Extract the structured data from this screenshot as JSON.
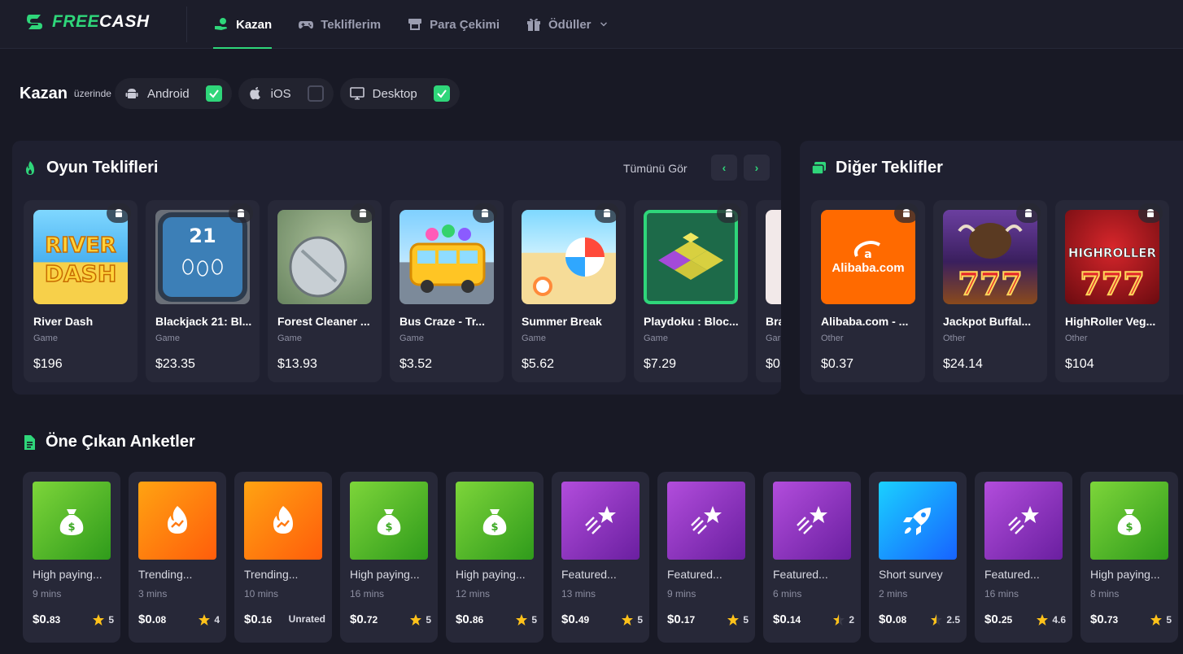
{
  "brand": {
    "free": "FREE",
    "cash": "CASH",
    "accent": "#2fd67a"
  },
  "nav": [
    {
      "label": "Kazan",
      "icon": "hand-coin-icon",
      "active": true
    },
    {
      "label": "Tekliflerim",
      "icon": "gamepad-icon",
      "active": false
    },
    {
      "label": "Para Çekimi",
      "icon": "atm-icon",
      "active": false
    },
    {
      "label": "Ödüller",
      "icon": "gift-icon",
      "active": false
    }
  ],
  "filter": {
    "title": "Kazan",
    "sub": "üzerinde",
    "platforms": [
      {
        "label": "Android",
        "icon": "android-icon",
        "checked": true
      },
      {
        "label": "iOS",
        "icon": "apple-icon",
        "checked": false
      },
      {
        "label": "Desktop",
        "icon": "monitor-icon",
        "checked": true
      }
    ]
  },
  "game_offers": {
    "title": "Oyun Teklifleri",
    "see_all": "Tümünü Gör",
    "items": [
      {
        "name": "River Dash",
        "category": "Game",
        "price": "$196"
      },
      {
        "name": "Blackjack 21: Bl...",
        "category": "Game",
        "price": "$23.35"
      },
      {
        "name": "Forest Cleaner ...",
        "category": "Game",
        "price": "$13.93"
      },
      {
        "name": "Bus Craze - Tr...",
        "category": "Game",
        "price": "$3.52"
      },
      {
        "name": "Summer Break",
        "category": "Game",
        "price": "$5.62"
      },
      {
        "name": "Playdoku : Bloc...",
        "category": "Game",
        "price": "$7.29"
      },
      {
        "name": "Bra",
        "category": "Gar",
        "price": "$0"
      }
    ]
  },
  "other_offers": {
    "title": "Diğer Teklifler",
    "items": [
      {
        "name": "Alibaba.com - ...",
        "category": "Other",
        "price": "$0.37",
        "logo_text": "Alibaba.com"
      },
      {
        "name": "Jackpot Buffal...",
        "category": "Other",
        "price": "$24.14",
        "logo_text": "777"
      },
      {
        "name": "HighRoller Veg...",
        "category": "Other",
        "price": "$104",
        "logo_text": "HIGHROLLER",
        "logo_sub": "777"
      }
    ]
  },
  "art_text": {
    "river1": "RIVER",
    "river2": "DASH",
    "bj": "21"
  },
  "surveys": {
    "title": "Öne Çıkan Anketler",
    "items": [
      {
        "title": "High paying...",
        "time": "9 mins",
        "price_main": "$0.",
        "price_cents": "83",
        "rating": "5",
        "icon": "money-bag-icon",
        "color": "green",
        "star": "full"
      },
      {
        "title": "Trending...",
        "time": "3 mins",
        "price_main": "$0.",
        "price_cents": "08",
        "rating": "4",
        "icon": "trending-flame-icon",
        "color": "orange",
        "star": "full"
      },
      {
        "title": "Trending...",
        "time": "10 mins",
        "price_main": "$0.",
        "price_cents": "16",
        "rating": "Unrated",
        "icon": "trending-flame-icon",
        "color": "orange",
        "star": "none"
      },
      {
        "title": "High paying...",
        "time": "16 mins",
        "price_main": "$0.",
        "price_cents": "72",
        "rating": "5",
        "icon": "money-bag-icon",
        "color": "green",
        "star": "full"
      },
      {
        "title": "High paying...",
        "time": "12 mins",
        "price_main": "$0.",
        "price_cents": "86",
        "rating": "5",
        "icon": "money-bag-icon",
        "color": "green",
        "star": "full"
      },
      {
        "title": "Featured...",
        "time": "13 mins",
        "price_main": "$0.",
        "price_cents": "49",
        "rating": "5",
        "icon": "shooting-star-icon",
        "color": "purple",
        "star": "full"
      },
      {
        "title": "Featured...",
        "time": "9 mins",
        "price_main": "$0.",
        "price_cents": "17",
        "rating": "5",
        "icon": "shooting-star-icon",
        "color": "purple",
        "star": "full"
      },
      {
        "title": "Featured...",
        "time": "6 mins",
        "price_main": "$0.",
        "price_cents": "14",
        "rating": "2",
        "icon": "shooting-star-icon",
        "color": "purple",
        "star": "half"
      },
      {
        "title": "Short survey",
        "time": "2 mins",
        "price_main": "$0.",
        "price_cents": "08",
        "rating": "2.5",
        "icon": "rocket-icon",
        "color": "blue",
        "star": "half"
      },
      {
        "title": "Featured...",
        "time": "16 mins",
        "price_main": "$0.",
        "price_cents": "25",
        "rating": "4.6",
        "icon": "shooting-star-icon",
        "color": "purple",
        "star": "full"
      },
      {
        "title": "High paying...",
        "time": "8 mins",
        "price_main": "$0.",
        "price_cents": "73",
        "rating": "5",
        "icon": "money-bag-icon",
        "color": "green",
        "star": "full"
      }
    ]
  }
}
